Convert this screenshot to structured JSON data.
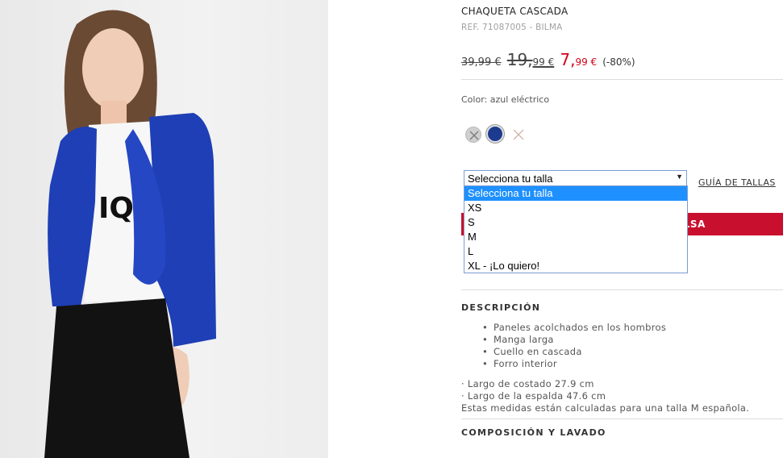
{
  "product": {
    "title": "CHAQUETA CASCADA",
    "reference": "REF. 71087005 - BILMA",
    "price_original": "39,99 €",
    "price_previous_main": "19,",
    "price_previous_cents": "99 €",
    "price_current_main": "7,",
    "price_current_cents": "99 €",
    "discount": "(-80%)",
    "color_label": "Color: azul eléctrico",
    "accent_color": "#c8102e",
    "swatches": [
      {
        "name": "grey",
        "hex": "#cfcfcf"
      },
      {
        "name": "azul eléctrico",
        "hex": "#1c3b8f"
      }
    ]
  },
  "size_select": {
    "selected": "Selecciona tu talla",
    "options": [
      "Selecciona tu talla",
      "XS",
      "S",
      "M",
      "L",
      "XL - ¡Lo quiero!"
    ]
  },
  "size_guide_label": "GUÍA DE TALLAS",
  "add_button_visible_text": "LSA",
  "description": {
    "title": "DESCRIPCIÓN",
    "bullets": [
      "Paneles acolchados en los hombros",
      "Manga larga",
      "Cuello en cascada",
      "Forro interior"
    ],
    "measures": [
      "· Largo de costado 27.9 cm",
      "· Largo de la espalda 47.6 cm",
      "Estas medidas están calculadas para una talla M española."
    ]
  },
  "composition_title": "COMPOSICIÓN Y LAVADO"
}
